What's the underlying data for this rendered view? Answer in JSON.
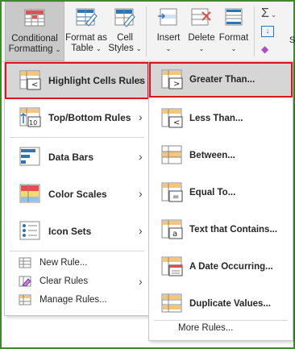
{
  "ribbon": {
    "conditional": {
      "line1": "Conditional",
      "line2": "Formatting"
    },
    "format_table": {
      "line1": "Format as",
      "line2": "Table"
    },
    "cell_styles": {
      "line1": "Cell",
      "line2": "Styles"
    },
    "insert": {
      "label": "Insert"
    },
    "delete": {
      "label": "Delete"
    },
    "format": {
      "label": "Format"
    },
    "sigma_cut": "S"
  },
  "menu": {
    "items": [
      {
        "label": "Highlight Cells Rules",
        "icon": "highlight-cells-icon"
      },
      {
        "label": "Top/Bottom Rules",
        "icon": "top-bottom-icon"
      },
      {
        "label": "Data Bars",
        "icon": "data-bars-icon"
      },
      {
        "label": "Color Scales",
        "icon": "color-scales-icon"
      },
      {
        "label": "Icon Sets",
        "icon": "icon-sets-icon"
      }
    ],
    "small": [
      {
        "label": "New Rule..."
      },
      {
        "label": "Clear Rules"
      },
      {
        "label": "Manage Rules..."
      }
    ]
  },
  "submenu": {
    "items": [
      {
        "label": "Greater Than..."
      },
      {
        "label": "Less Than..."
      },
      {
        "label": "Between..."
      },
      {
        "label": "Equal To..."
      },
      {
        "label": "Text that Contains..."
      },
      {
        "label": "A Date Occurring..."
      },
      {
        "label": "Duplicate Values..."
      }
    ],
    "more": "More Rules..."
  },
  "colors": {
    "highlight_outline": "#e0151b",
    "frame": "#3d8a2c",
    "orange": "#f5a623",
    "blue": "#2e75b6",
    "red": "#e04b4b"
  }
}
